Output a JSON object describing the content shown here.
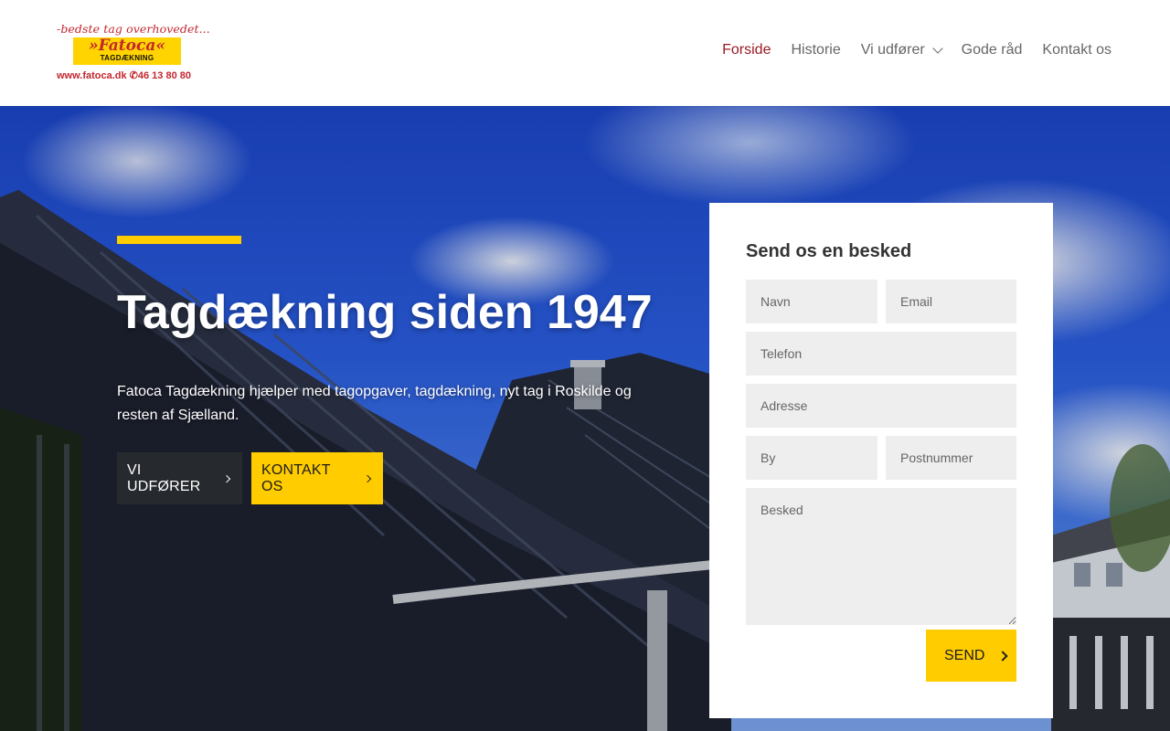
{
  "logo": {
    "tagline": "-bedste tag overhovedet...",
    "name": "»Fatoca«",
    "sub": "TAGDÆKNING",
    "contact": "www.fatoca.dk  ✆46 13 80 80"
  },
  "nav": {
    "items": [
      {
        "label": "Forside",
        "active": true
      },
      {
        "label": "Historie"
      },
      {
        "label": "Vi udfører",
        "dropdown": true
      },
      {
        "label": "Gode råd"
      },
      {
        "label": "Kontakt os"
      }
    ]
  },
  "hero": {
    "title": "Tagdækning siden 1947",
    "text": "Fatoca Tagdækning hjælper med tagopgaver, tagdækning, nyt tag i Roskilde og resten af Sjælland.",
    "button_primary": "VI UDFØRER",
    "button_secondary": "KONTAKT OS"
  },
  "form": {
    "title": "Send os en besked",
    "navn_placeholder": "Navn",
    "email_placeholder": "Email",
    "telefon_placeholder": "Telefon",
    "adresse_placeholder": "Adresse",
    "by_placeholder": "By",
    "postnummer_placeholder": "Postnummer",
    "besked_placeholder": "Besked",
    "send_label": "SEND"
  },
  "colors": {
    "accent_yellow": "#ffcc00",
    "active_nav": "#9b1b22",
    "dark_button": "#26292e",
    "logo_red": "#c3272e"
  }
}
